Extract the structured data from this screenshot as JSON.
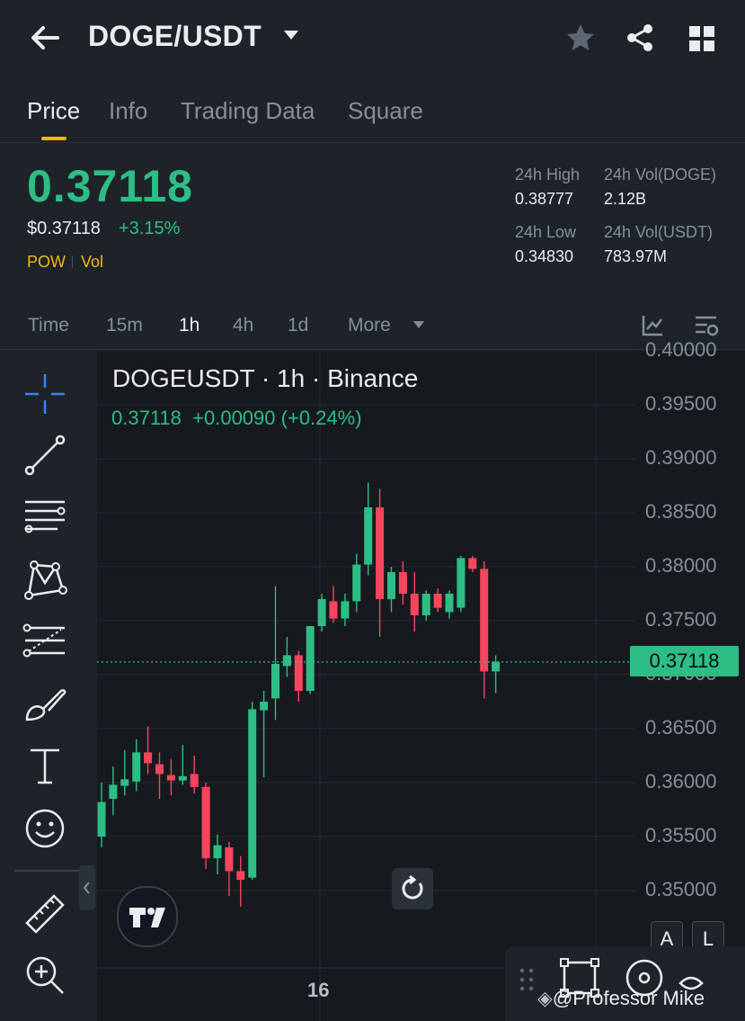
{
  "header": {
    "pair": "DOGE/USDT",
    "icons": [
      "back-arrow-icon",
      "dropdown-caret-icon",
      "star-icon",
      "share-icon",
      "grid-menu-icon"
    ]
  },
  "tabs": [
    {
      "label": "Price",
      "active": true
    },
    {
      "label": "Info",
      "active": false
    },
    {
      "label": "Trading Data",
      "active": false
    },
    {
      "label": "Square",
      "active": false
    }
  ],
  "ticker": {
    "last_price": "0.37118",
    "usd_price": "$0.37118",
    "change_pct": "+3.15%",
    "tag_1": "POW",
    "tag_2": "Vol"
  },
  "stats": {
    "high_label": "24h High",
    "high_value": "0.38777",
    "vol_base_label": "24h Vol(DOGE)",
    "vol_base_value": "2.12B",
    "low_label": "24h Low",
    "low_value": "0.34830",
    "vol_quote_label": "24h Vol(USDT)",
    "vol_quote_value": "783.97M"
  },
  "intervals": {
    "items": [
      "Time",
      "15m",
      "1h",
      "4h",
      "1d",
      "More"
    ],
    "active": "1h"
  },
  "chart_header": {
    "title": "DOGEUSDT · 1h · Binance",
    "last": "0.37118",
    "change": "+0.00090",
    "change_pct": "(+0.24%)"
  },
  "chart_data": {
    "type": "candlestick",
    "title": "DOGEUSDT · 1h · Binance",
    "y_ticks": [
      "0.40000",
      "0.39500",
      "0.39000",
      "0.38500",
      "0.38000",
      "0.37500",
      "0.37000",
      "0.36500",
      "0.36000",
      "0.35500",
      "0.35000"
    ],
    "ylim": [
      0.346,
      0.4002
    ],
    "x_ticks": [
      "16"
    ],
    "current_price": "0.37118",
    "candles": [
      {
        "o": 0.355,
        "h": 0.36,
        "l": 0.354,
        "c": 0.3582
      },
      {
        "o": 0.3585,
        "h": 0.3615,
        "l": 0.357,
        "c": 0.3598
      },
      {
        "o": 0.3597,
        "h": 0.363,
        "l": 0.3588,
        "c": 0.3603
      },
      {
        "o": 0.3601,
        "h": 0.364,
        "l": 0.3592,
        "c": 0.3628
      },
      {
        "o": 0.3628,
        "h": 0.3652,
        "l": 0.3608,
        "c": 0.3618
      },
      {
        "o": 0.3617,
        "h": 0.3628,
        "l": 0.3585,
        "c": 0.3608
      },
      {
        "o": 0.3607,
        "h": 0.3622,
        "l": 0.3588,
        "c": 0.3602
      },
      {
        "o": 0.3602,
        "h": 0.3635,
        "l": 0.3598,
        "c": 0.3606
      },
      {
        "o": 0.3608,
        "h": 0.3625,
        "l": 0.359,
        "c": 0.3596
      },
      {
        "o": 0.3596,
        "h": 0.36,
        "l": 0.352,
        "c": 0.353
      },
      {
        "o": 0.353,
        "h": 0.3552,
        "l": 0.3515,
        "c": 0.3542
      },
      {
        "o": 0.354,
        "h": 0.3545,
        "l": 0.3495,
        "c": 0.3518
      },
      {
        "o": 0.3518,
        "h": 0.3532,
        "l": 0.3485,
        "c": 0.351
      },
      {
        "o": 0.3512,
        "h": 0.3675,
        "l": 0.351,
        "c": 0.3668
      },
      {
        "o": 0.3667,
        "h": 0.3685,
        "l": 0.3605,
        "c": 0.3675
      },
      {
        "o": 0.3678,
        "h": 0.3782,
        "l": 0.3658,
        "c": 0.371
      },
      {
        "o": 0.3708,
        "h": 0.3735,
        "l": 0.3698,
        "c": 0.3718
      },
      {
        "o": 0.3718,
        "h": 0.3722,
        "l": 0.3675,
        "c": 0.3685
      },
      {
        "o": 0.3685,
        "h": 0.3745,
        "l": 0.3682,
        "c": 0.3745
      },
      {
        "o": 0.3745,
        "h": 0.3775,
        "l": 0.374,
        "c": 0.377
      },
      {
        "o": 0.3768,
        "h": 0.3782,
        "l": 0.3748,
        "c": 0.3752
      },
      {
        "o": 0.3752,
        "h": 0.3775,
        "l": 0.3745,
        "c": 0.3768
      },
      {
        "o": 0.3768,
        "h": 0.3812,
        "l": 0.3758,
        "c": 0.3802
      },
      {
        "o": 0.3802,
        "h": 0.3878,
        "l": 0.3792,
        "c": 0.3855
      },
      {
        "o": 0.3855,
        "h": 0.3872,
        "l": 0.3735,
        "c": 0.377
      },
      {
        "o": 0.377,
        "h": 0.38,
        "l": 0.3758,
        "c": 0.3795
      },
      {
        "o": 0.3795,
        "h": 0.3805,
        "l": 0.3765,
        "c": 0.3775
      },
      {
        "o": 0.3775,
        "h": 0.3795,
        "l": 0.374,
        "c": 0.3755
      },
      {
        "o": 0.3755,
        "h": 0.3778,
        "l": 0.375,
        "c": 0.3775
      },
      {
        "o": 0.3775,
        "h": 0.378,
        "l": 0.3758,
        "c": 0.3762
      },
      {
        "o": 0.3758,
        "h": 0.3778,
        "l": 0.3752,
        "c": 0.3775
      },
      {
        "o": 0.3762,
        "h": 0.381,
        "l": 0.3758,
        "c": 0.3808
      },
      {
        "o": 0.3808,
        "h": 0.381,
        "l": 0.3795,
        "c": 0.3798
      },
      {
        "o": 0.3798,
        "h": 0.3805,
        "l": 0.3678,
        "c": 0.3703
      },
      {
        "o": 0.3703,
        "h": 0.3718,
        "l": 0.3683,
        "c": 0.3712
      }
    ]
  },
  "axis_buttons": {
    "auto": "A",
    "log": "L"
  },
  "xaxis": {
    "label": "16"
  },
  "watermark": "@Professor Mike",
  "colors": {
    "up": "#2ebd85",
    "down": "#f6465d",
    "accent": "#f0b90b",
    "background": "#1e2329"
  }
}
